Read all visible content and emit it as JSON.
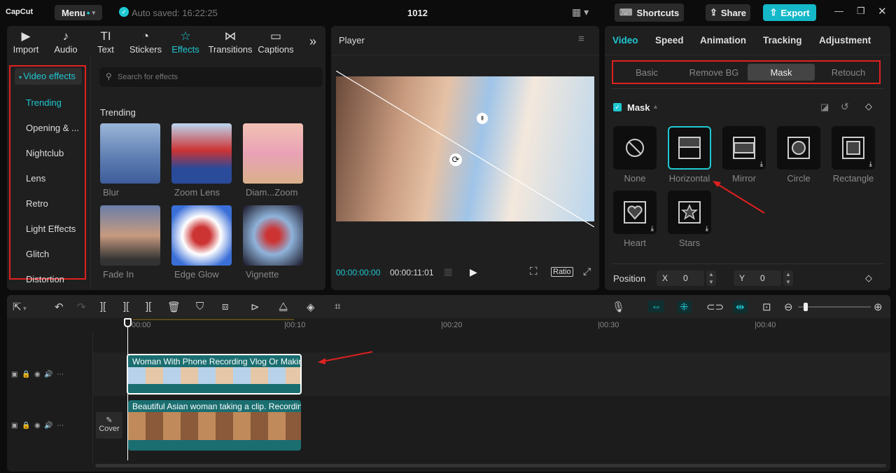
{
  "app": {
    "logo": "CapCut",
    "menu": "Menu",
    "autosave": "Auto saved: 16:22:25",
    "project": "1012",
    "shortcuts": "Shortcuts",
    "share": "Share",
    "export": "Export"
  },
  "left_tabs": [
    {
      "label": "Import",
      "icon": "▶"
    },
    {
      "label": "Audio",
      "icon": "♪"
    },
    {
      "label": "Text",
      "icon": "TI"
    },
    {
      "label": "Stickers",
      "icon": "◔"
    },
    {
      "label": "Effects",
      "icon": "☆"
    },
    {
      "label": "Transitions",
      "icon": "⋈"
    },
    {
      "label": "Captions",
      "icon": "▭"
    }
  ],
  "sidebar": {
    "header": "Video effects",
    "items": [
      "Trending",
      "Opening & ...",
      "Nightclub",
      "Lens",
      "Retro",
      "Light Effects",
      "Glitch",
      "Distortion"
    ]
  },
  "effects": {
    "search_placeholder": "Search for effects",
    "section": "Trending",
    "items": [
      "Blur",
      "Zoom Lens",
      "Diam...Zoom",
      "Fade In",
      "Edge Glow",
      "Vignette"
    ]
  },
  "player": {
    "title": "Player",
    "current_time": "00:00:00:00",
    "total_time": "00:00:11:01",
    "ratio": "Ratio"
  },
  "right": {
    "tabs": [
      "Video",
      "Speed",
      "Animation",
      "Tracking",
      "Adjustment"
    ],
    "subtabs": [
      "Basic",
      "Remove BG",
      "Mask",
      "Retouch"
    ],
    "mask_title": "Mask",
    "masks": [
      "None",
      "Horizontal",
      "Mirror",
      "Circle",
      "Rectangle",
      "Heart",
      "Stars"
    ],
    "position_label": "Position",
    "x_label": "X",
    "x_value": "0",
    "y_label": "Y",
    "y_value": "0"
  },
  "timeline": {
    "ticks": [
      "00:00",
      "|00:10",
      "|00:20",
      "|00:30",
      "|00:40"
    ],
    "clip1": "Woman With Phone Recording Vlog Or Making",
    "clip2": "Beautiful Asian woman taking a clip. Recording",
    "cover": "Cover"
  },
  "colors": {
    "accent": "#1fc8d2",
    "export": "#14b8c8",
    "annotation": "#e02020"
  }
}
